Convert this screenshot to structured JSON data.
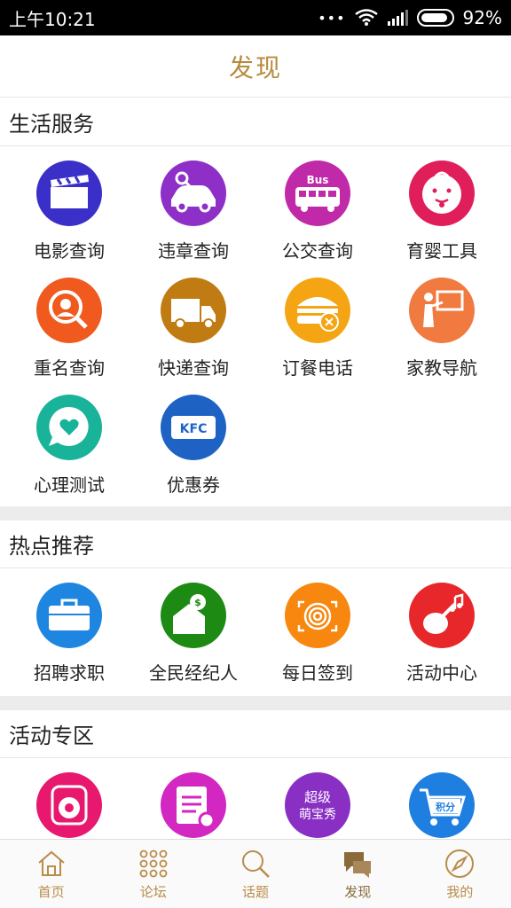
{
  "status_bar": {
    "time": "上午10:21",
    "dots": "•••",
    "battery": "92%"
  },
  "page": {
    "title": "发现"
  },
  "sections": {
    "life": {
      "title": "生活服务",
      "items": [
        {
          "label": "电影查询",
          "icon": "film-clapper-icon",
          "color": "#3b2fc9"
        },
        {
          "label": "违章查询",
          "icon": "car-search-icon",
          "color": "#8e2fc8"
        },
        {
          "label": "公交查询",
          "icon": "bus-icon",
          "color": "#c02aa8",
          "icon_text": "Bus"
        },
        {
          "label": "育婴工具",
          "icon": "baby-face-icon",
          "color": "#e01e5a"
        },
        {
          "label": "重名查询",
          "icon": "name-search-icon",
          "color": "#f05a1e"
        },
        {
          "label": "快递查询",
          "icon": "delivery-truck-icon",
          "color": "#c07c12"
        },
        {
          "label": "订餐电话",
          "icon": "burger-cutlery-icon",
          "color": "#f5a514"
        },
        {
          "label": "家教导航",
          "icon": "teacher-board-icon",
          "color": "#f07a40"
        },
        {
          "label": "心理测试",
          "icon": "heart-chat-icon",
          "color": "#19b39a"
        },
        {
          "label": "优惠券",
          "icon": "kfc-coupon-icon",
          "color": "#1e63c4",
          "icon_text": "KFC"
        }
      ]
    },
    "hot": {
      "title": "热点推荐",
      "items": [
        {
          "label": "招聘求职",
          "icon": "briefcase-icon",
          "color": "#1e86e0"
        },
        {
          "label": "全民经纪人",
          "icon": "house-money-icon",
          "color": "#1d8a14"
        },
        {
          "label": "每日签到",
          "icon": "fingerprint-icon",
          "color": "#f7870f"
        },
        {
          "label": "活动中心",
          "icon": "guitar-music-icon",
          "color": "#e8272b"
        }
      ]
    },
    "events": {
      "title": "活动专区",
      "items": [
        {
          "label": "",
          "icon": "speaker-icon",
          "color": "#e8186e"
        },
        {
          "label": "",
          "icon": "notepad-gear-icon",
          "color": "#d327c2"
        },
        {
          "label": "",
          "icon": "cute-baby-show-icon",
          "color": "#8a2fc4",
          "icon_text_1": "超级",
          "icon_text_2": "萌宝秀"
        },
        {
          "label": "",
          "icon": "points-cart-icon",
          "color": "#1e7fe0",
          "icon_text": "积分"
        }
      ]
    }
  },
  "tabs": [
    {
      "label": "首页",
      "icon": "home-icon",
      "active": false
    },
    {
      "label": "论坛",
      "icon": "grid-dots-icon",
      "active": false
    },
    {
      "label": "话题",
      "icon": "search-icon",
      "active": false
    },
    {
      "label": "发现",
      "icon": "chat-bubbles-icon",
      "active": true
    },
    {
      "label": "我的",
      "icon": "compass-icon",
      "active": false
    }
  ]
}
